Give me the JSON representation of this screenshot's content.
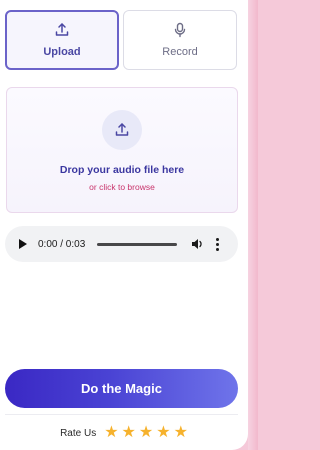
{
  "tabs": [
    {
      "label": "Upload",
      "icon": "upload-icon",
      "selected": true
    },
    {
      "label": "Record",
      "icon": "microphone-icon",
      "selected": false
    }
  ],
  "dropzone": {
    "title": "Drop your audio file here",
    "subtitle": "or click to browse",
    "icon": "upload-icon"
  },
  "player": {
    "time": "0:00 / 0:03",
    "progress": 0
  },
  "action": {
    "label": "Do the Magic"
  },
  "rating": {
    "label": "Rate Us",
    "stars": [
      "★",
      "★",
      "★",
      "★",
      "★"
    ]
  },
  "colors": {
    "accent": "#4a47a3",
    "button_start": "#3a28c4",
    "button_end": "#6f74ea",
    "star": "#f6b22d",
    "browse": "#c8336b"
  }
}
